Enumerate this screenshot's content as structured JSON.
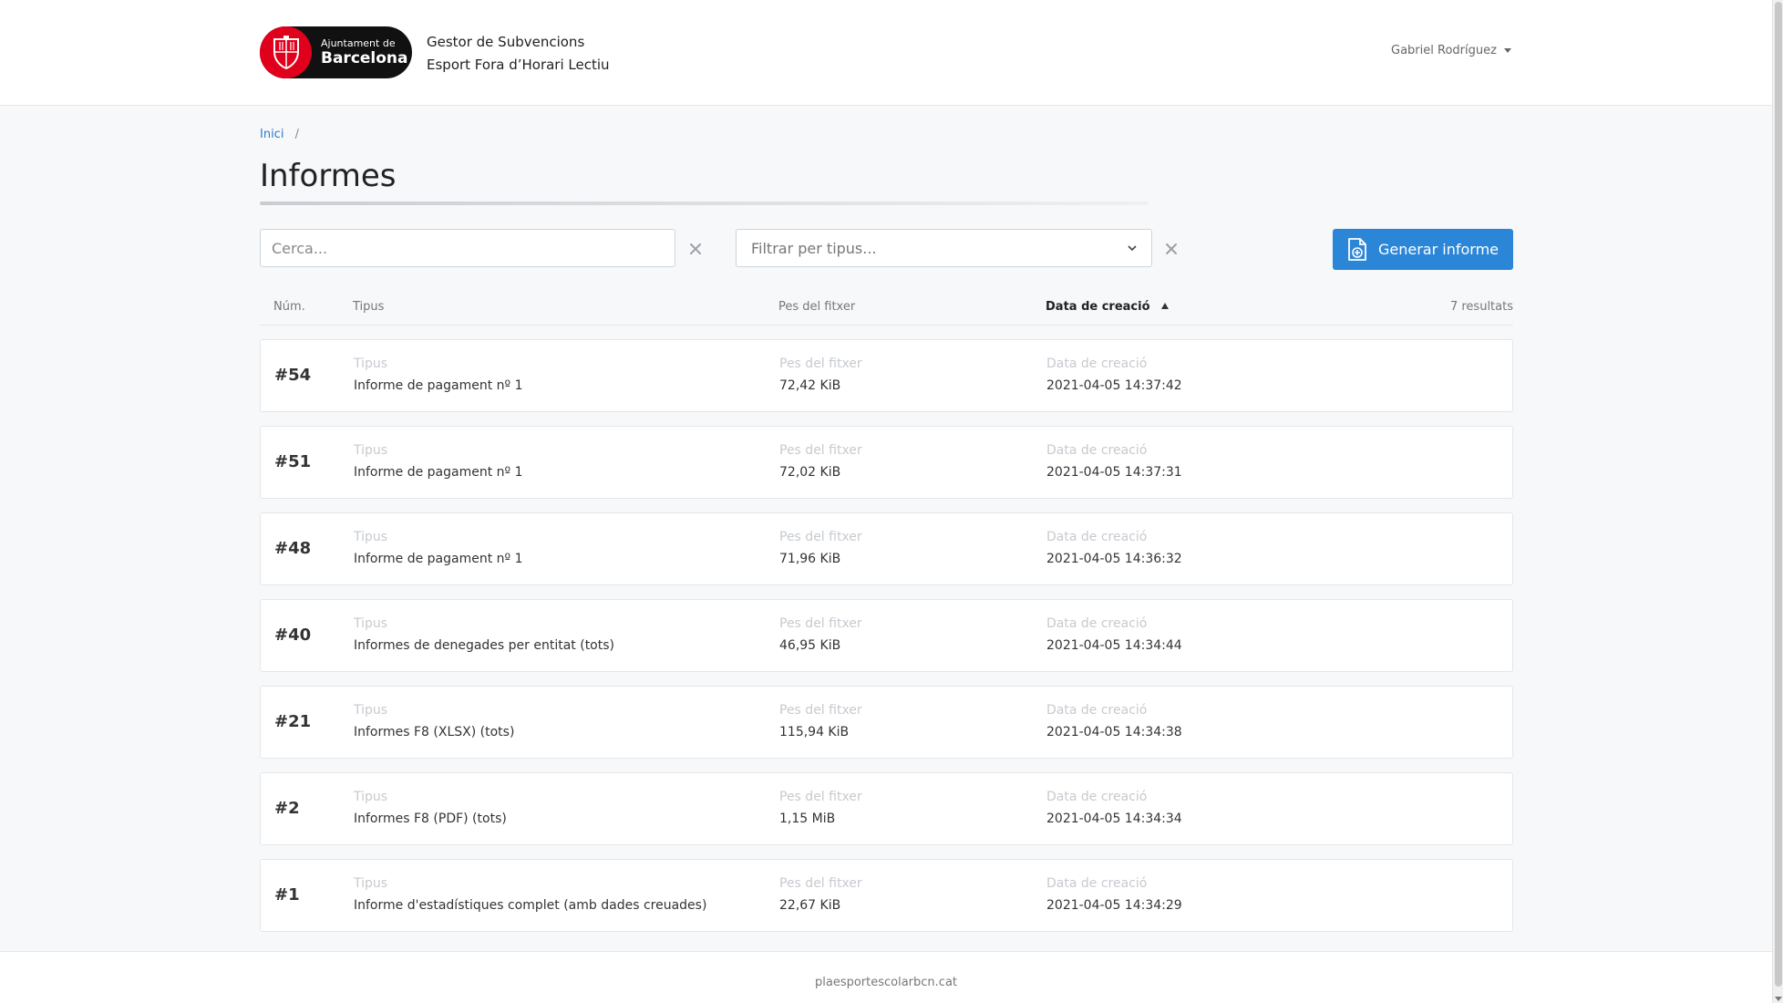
{
  "header": {
    "logo_small": "Ajuntament de",
    "logo_big": "Barcelona",
    "title_line1": "Gestor de Subvencions",
    "title_line2": "Esport Fora d’Horari Lectiu",
    "user_name": "Gabriel Rodríguez"
  },
  "breadcrumb": {
    "home": "Inici",
    "separator": "/"
  },
  "page": {
    "title": "Informes"
  },
  "filters": {
    "search_placeholder": "Cerca...",
    "type_placeholder": "Filtrar per tipus...",
    "generate_label": "Generar informe"
  },
  "table": {
    "headers": {
      "num": "Núm.",
      "tipus": "Tipus",
      "pes": "Pes del fitxer",
      "data": "Data de creació"
    },
    "results_count": "7 resultats",
    "rows": [
      {
        "num": "#54",
        "tipus_label": "Tipus",
        "tipus": "Informe de pagament nº 1",
        "pes_label": "Pes del fitxer",
        "pes": "72,42 KiB",
        "data_label": "Data de creació",
        "data": "2021-04-05 14:37:42"
      },
      {
        "num": "#51",
        "tipus_label": "Tipus",
        "tipus": "Informe de pagament nº 1",
        "pes_label": "Pes del fitxer",
        "pes": "72,02 KiB",
        "data_label": "Data de creació",
        "data": "2021-04-05 14:37:31"
      },
      {
        "num": "#48",
        "tipus_label": "Tipus",
        "tipus": "Informe de pagament nº 1",
        "pes_label": "Pes del fitxer",
        "pes": "71,96 KiB",
        "data_label": "Data de creació",
        "data": "2021-04-05 14:36:32"
      },
      {
        "num": "#40",
        "tipus_label": "Tipus",
        "tipus": "Informes de denegades per entitat (tots)",
        "pes_label": "Pes del fitxer",
        "pes": "46,95 KiB",
        "data_label": "Data de creació",
        "data": "2021-04-05 14:34:44"
      },
      {
        "num": "#21",
        "tipus_label": "Tipus",
        "tipus": "Informes F8 (XLSX) (tots)",
        "pes_label": "Pes del fitxer",
        "pes": "115,94 KiB",
        "data_label": "Data de creació",
        "data": "2021-04-05 14:34:38"
      },
      {
        "num": "#2",
        "tipus_label": "Tipus",
        "tipus": "Informes F8 (PDF) (tots)",
        "pes_label": "Pes del fitxer",
        "pes": "1,15 MiB",
        "data_label": "Data de creació",
        "data": "2021-04-05 14:34:34"
      },
      {
        "num": "#1",
        "tipus_label": "Tipus",
        "tipus": "Informe d'estadístiques complet (amb dades creuades)",
        "pes_label": "Pes del fitxer",
        "pes": "22,67 KiB",
        "data_label": "Data de creació",
        "data": "2021-04-05 14:34:29"
      }
    ]
  },
  "footer": {
    "text": "plaesportescolarbcn.cat"
  },
  "icons": {
    "logo": "barcelona-coat-of-arms-icon",
    "user_caret": "caret-down-icon",
    "clear": "close-icon",
    "select": "chevron-down-icon",
    "generate": "file-plus-icon",
    "sort": "sort-ascending-icon"
  },
  "colors": {
    "accent": "#2c86d8",
    "link": "#2a7ad1",
    "brand_red": "#e0001b"
  }
}
